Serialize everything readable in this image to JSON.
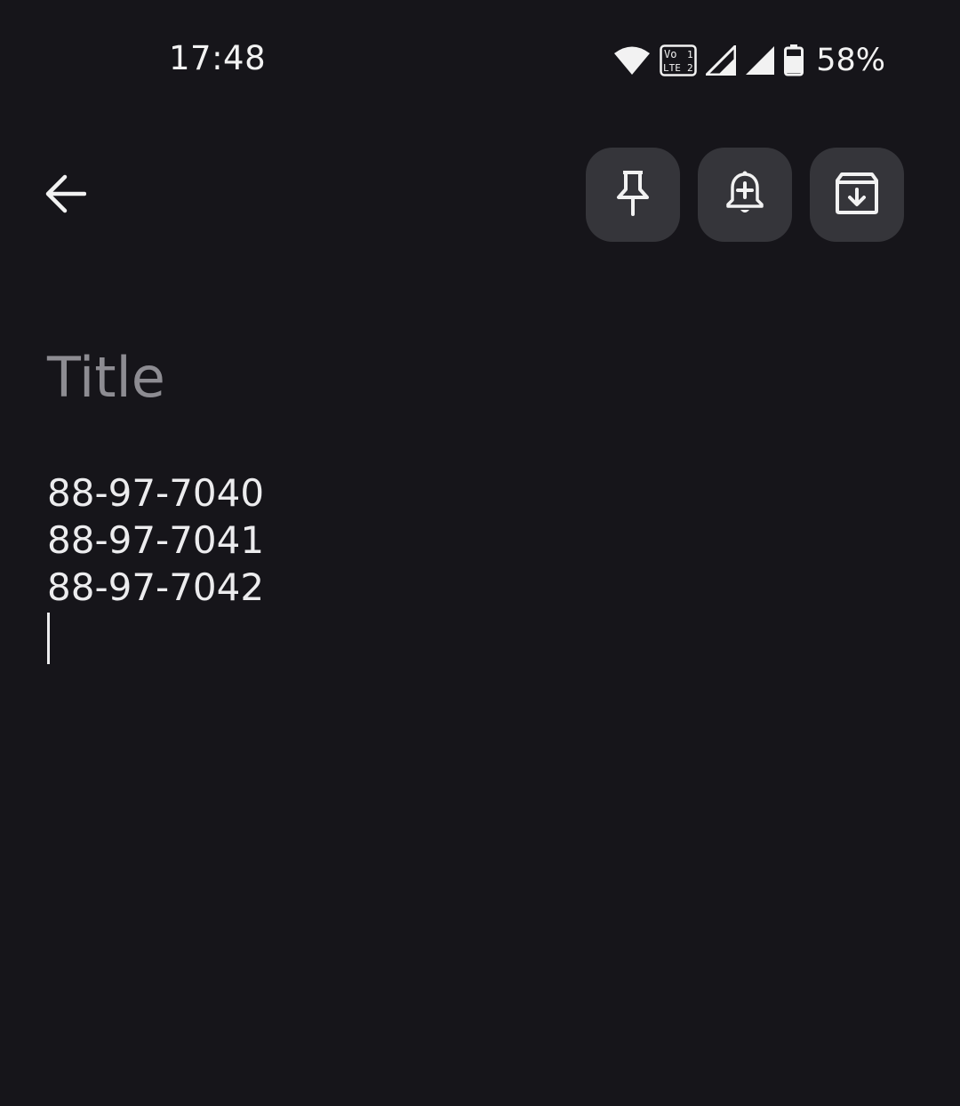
{
  "status_bar": {
    "time": "17:48",
    "volte_label_top": "Vo",
    "volte_label_bottom": "LTE",
    "sim_1": "1",
    "sim_2": "2",
    "battery_percent": "58%",
    "icons": [
      "wifi-icon",
      "volte-icon",
      "signal-sim1-icon",
      "signal-sim2-icon",
      "battery-icon"
    ]
  },
  "toolbar": {
    "back_icon": "arrow-back-icon",
    "actions": [
      "pin-icon",
      "add-reminder-icon",
      "archive-icon"
    ]
  },
  "note": {
    "title_placeholder": "Title",
    "lines": [
      "88-97-7040",
      "88-97-7041",
      "88-97-7042"
    ]
  },
  "colors": {
    "background": "#16151a",
    "button_bg": "#35353a",
    "placeholder": "#8d8c92",
    "text": "#ececee"
  }
}
